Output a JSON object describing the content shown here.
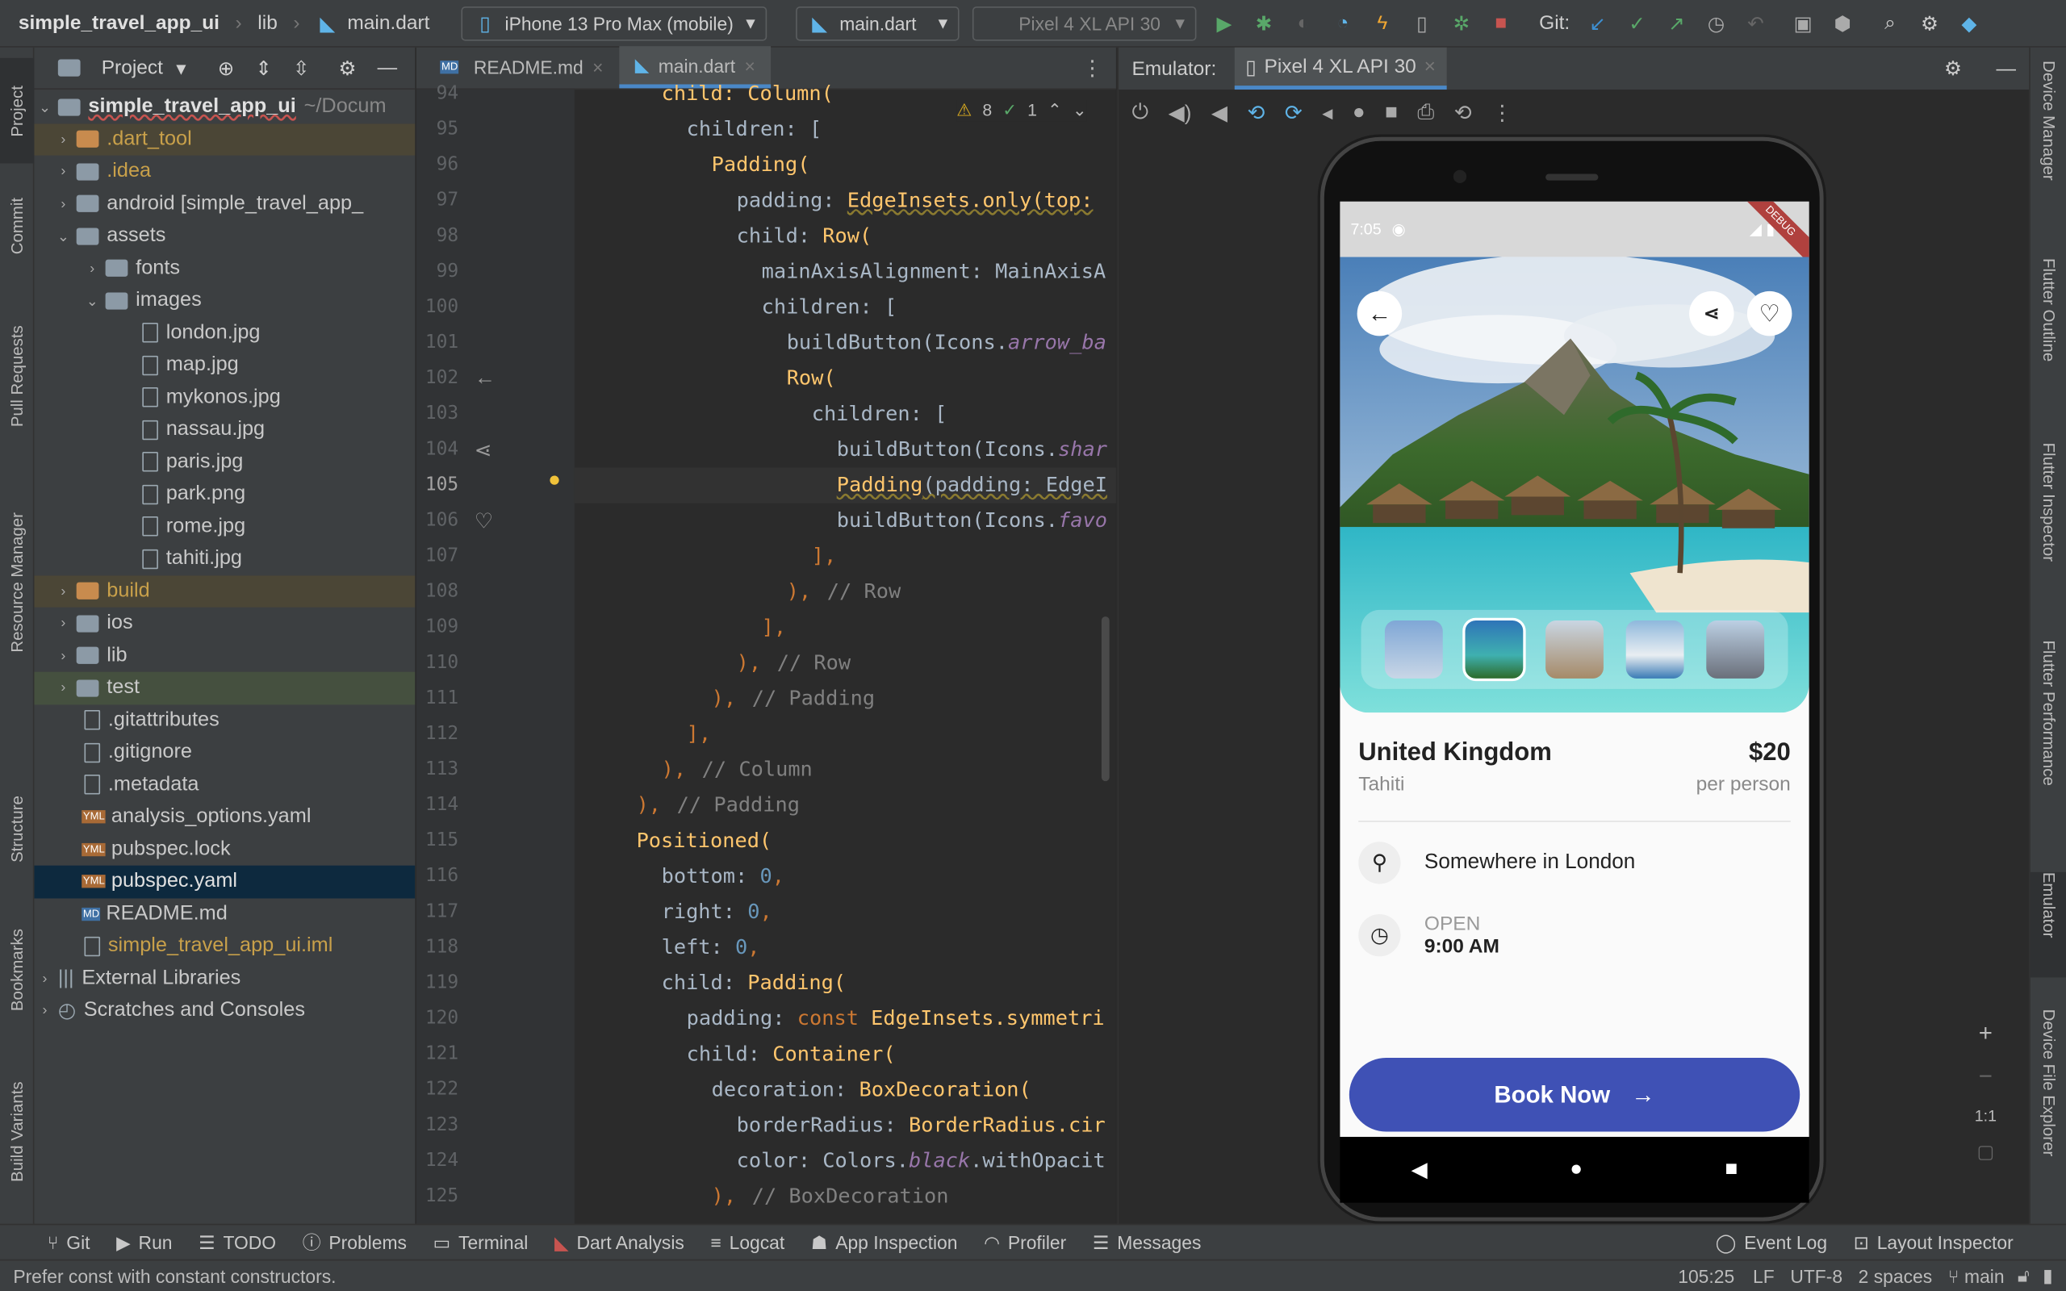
{
  "toolbar": {
    "project": "simple_travel_app_ui",
    "crumb_lib": "lib",
    "crumb_file": "main.dart",
    "device_select": "iPhone 13 Pro Max (mobile)",
    "run_config": "main.dart",
    "emulator_select": "Pixel 4 XL API 30",
    "git_label": "Git:"
  },
  "left_stripe": [
    "Project",
    "Commit",
    "Pull Requests",
    "Resource Manager",
    "Structure",
    "Bookmarks",
    "Build Variants"
  ],
  "project_panel": {
    "title": "Project",
    "root_name": "simple_travel_app_ui",
    "root_path": "~/Docum",
    "items": [
      {
        "label": ".dart_tool"
      },
      {
        "label": ".idea"
      },
      {
        "label": "android [simple_travel_app_"
      },
      {
        "label": "assets"
      },
      {
        "label": "fonts"
      },
      {
        "label": "images"
      },
      {
        "label": "london.jpg"
      },
      {
        "label": "map.jpg"
      },
      {
        "label": "mykonos.jpg"
      },
      {
        "label": "nassau.jpg"
      },
      {
        "label": "paris.jpg"
      },
      {
        "label": "park.png"
      },
      {
        "label": "rome.jpg"
      },
      {
        "label": "tahiti.jpg"
      },
      {
        "label": "build"
      },
      {
        "label": "ios"
      },
      {
        "label": "lib"
      },
      {
        "label": "test"
      },
      {
        "label": ".gitattributes"
      },
      {
        "label": ".gitignore"
      },
      {
        "label": ".metadata"
      },
      {
        "label": "analysis_options.yaml"
      },
      {
        "label": "pubspec.lock"
      },
      {
        "label": "pubspec.yaml"
      },
      {
        "label": "README.md"
      },
      {
        "label": "simple_travel_app_ui.iml"
      },
      {
        "label": "External Libraries"
      },
      {
        "label": "Scratches and Consoles"
      }
    ]
  },
  "editor": {
    "tabs": [
      "README.md",
      "main.dart"
    ],
    "inspection": {
      "warnings": "8",
      "ok": "1"
    },
    "line_numbers": [
      "94",
      "95",
      "96",
      "97",
      "98",
      "99",
      "100",
      "101",
      "102",
      "103",
      "104",
      "105",
      "106",
      "107",
      "108",
      "109",
      "110",
      "111",
      "112",
      "113",
      "114",
      "115",
      "116",
      "117",
      "118",
      "119",
      "120",
      "121",
      "122",
      "123",
      "124",
      "125"
    ],
    "lines": {
      "l94": "child: Column(",
      "l95": "children: [",
      "l96": "Padding(",
      "l97a": "padding: ",
      "l97b": "EdgeInsets.only(top:",
      "l98a": "child: ",
      "l98b": "Row(",
      "l99": "mainAxisAlignment: MainAxisA",
      "l100": "children: [",
      "l101a": "buildButton(Icons.",
      "l101b": "arrow_ba",
      "l102": "Row(",
      "l103": "children: [",
      "l104a": "buildButton(Icons.",
      "l104b": "shar",
      "l105a": "Padding",
      "l105b": "(padding: EdgeI",
      "l106a": "buildButton(Icons.",
      "l106b": "favo",
      "l107": "],",
      "l108a": "),",
      "l108b": "// Row",
      "l109": "],",
      "l110a": "),",
      "l110b": "// Row",
      "l111a": "),",
      "l111b": "// Padding",
      "l112": "],",
      "l113a": "),",
      "l113b": "// Column",
      "l114a": "),",
      "l114b": "// Padding",
      "l115": "Positioned(",
      "l116a": "bottom: ",
      "l116b": "0",
      "l116c": ",",
      "l117a": "right: ",
      "l117b": "0",
      "l117c": ",",
      "l118a": "left: ",
      "l118b": "0",
      "l118c": ",",
      "l119a": "child: ",
      "l119b": "Padding(",
      "l120a": "padding: ",
      "l120b": "const ",
      "l120c": "EdgeInsets.symmetri",
      "l121a": "child: ",
      "l121b": "Container(",
      "l122a": "decoration: ",
      "l122b": "BoxDecoration(",
      "l123a": "borderRadius: ",
      "l123b": "BorderRadius.cir",
      "l124a": "color: Colors.",
      "l124b": "black",
      "l124c": ".withOpacit",
      "l125a": "),",
      "l125b": "// BoxDecoration"
    }
  },
  "emulator": {
    "label": "Emulator:",
    "tab": "Pixel 4 XL API 30",
    "zoom_label": "1:1"
  },
  "phone": {
    "time": "7:05",
    "debug_banner": "DEBUG",
    "title": "United Kingdom",
    "subtitle": "Tahiti",
    "price": "$20",
    "per": "per person",
    "location": "Somewhere in London",
    "open_label": "OPEN",
    "open_time": "9:00 AM",
    "book_label": "Book Now",
    "book_color": "#3f51b5"
  },
  "right_stripe": [
    "Device Manager",
    "Flutter Outline",
    "Flutter Inspector",
    "Flutter Performance",
    "Emulator",
    "Device File Explorer"
  ],
  "bottom_tools": [
    "Git",
    "Run",
    "TODO",
    "Problems",
    "Terminal",
    "Dart Analysis",
    "Logcat",
    "App Inspection",
    "Profiler",
    "Messages"
  ],
  "bottom_right": [
    "Event Log",
    "Layout Inspector"
  ],
  "status": {
    "message": "Prefer const with constant constructors.",
    "position": "105:25",
    "line_sep": "LF",
    "encoding": "UTF-8",
    "indent": "2 spaces",
    "branch": "main"
  }
}
